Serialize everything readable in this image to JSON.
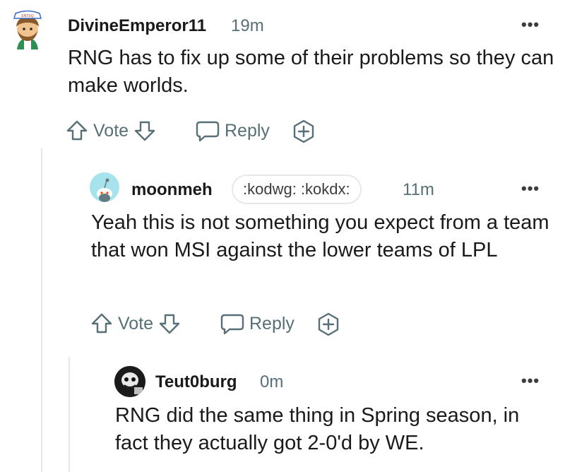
{
  "comments": [
    {
      "username": "DivineEmperor11",
      "time": "19m",
      "avatar_hat_text": "ENTEQ",
      "body": "RNG has to fix up some of their problems so they can make worlds.",
      "actions": {
        "vote": "Vote",
        "reply": "Reply"
      }
    },
    {
      "username": "moonmeh",
      "flair": ":kodwg: :kokdx:",
      "time": "11m",
      "body": "Yeah this is not something you expect from a team that won MSI against the lower teams of LPL",
      "actions": {
        "vote": "Vote",
        "reply": "Reply"
      }
    },
    {
      "username": "Teut0burg",
      "time": "0m",
      "body": "RNG did the same thing in Spring season, in fact they actually got 2-0'd by WE."
    }
  ],
  "more_icon": "ellipsis-icon",
  "colors": {
    "text": "#1a1a1b",
    "meta": "#576f76",
    "thread": "#e5e7ea",
    "snoo_bg": "#a7e3ec"
  }
}
